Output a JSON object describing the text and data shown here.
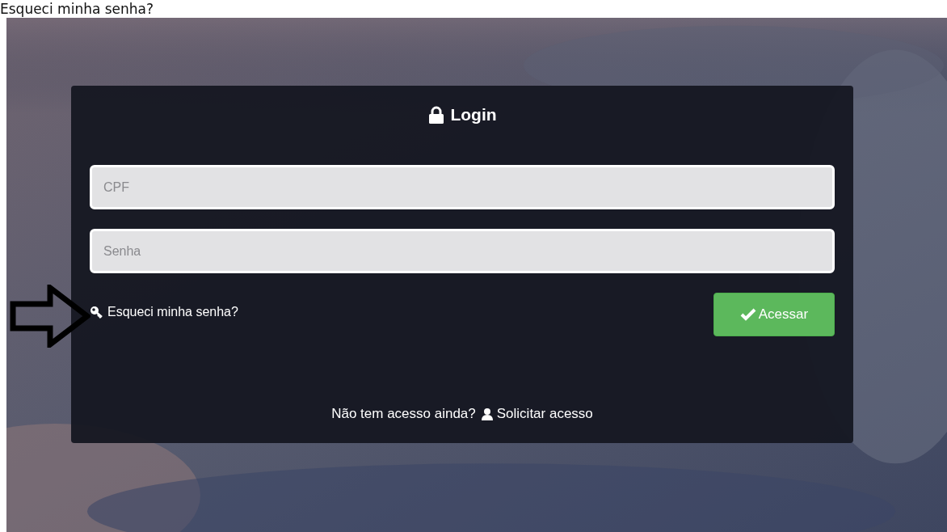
{
  "caption": "Esqueci minha senha?",
  "login": {
    "title": "Login",
    "fields": [
      {
        "placeholder": "CPF"
      },
      {
        "placeholder": "Senha"
      }
    ],
    "forgot_link": "Esqueci minha senha?",
    "submit": "Acessar",
    "footer_text": "Não tem acesso ainda?",
    "request_link": "Solicitar acesso"
  },
  "annotation": {
    "kind": "arrow"
  }
}
